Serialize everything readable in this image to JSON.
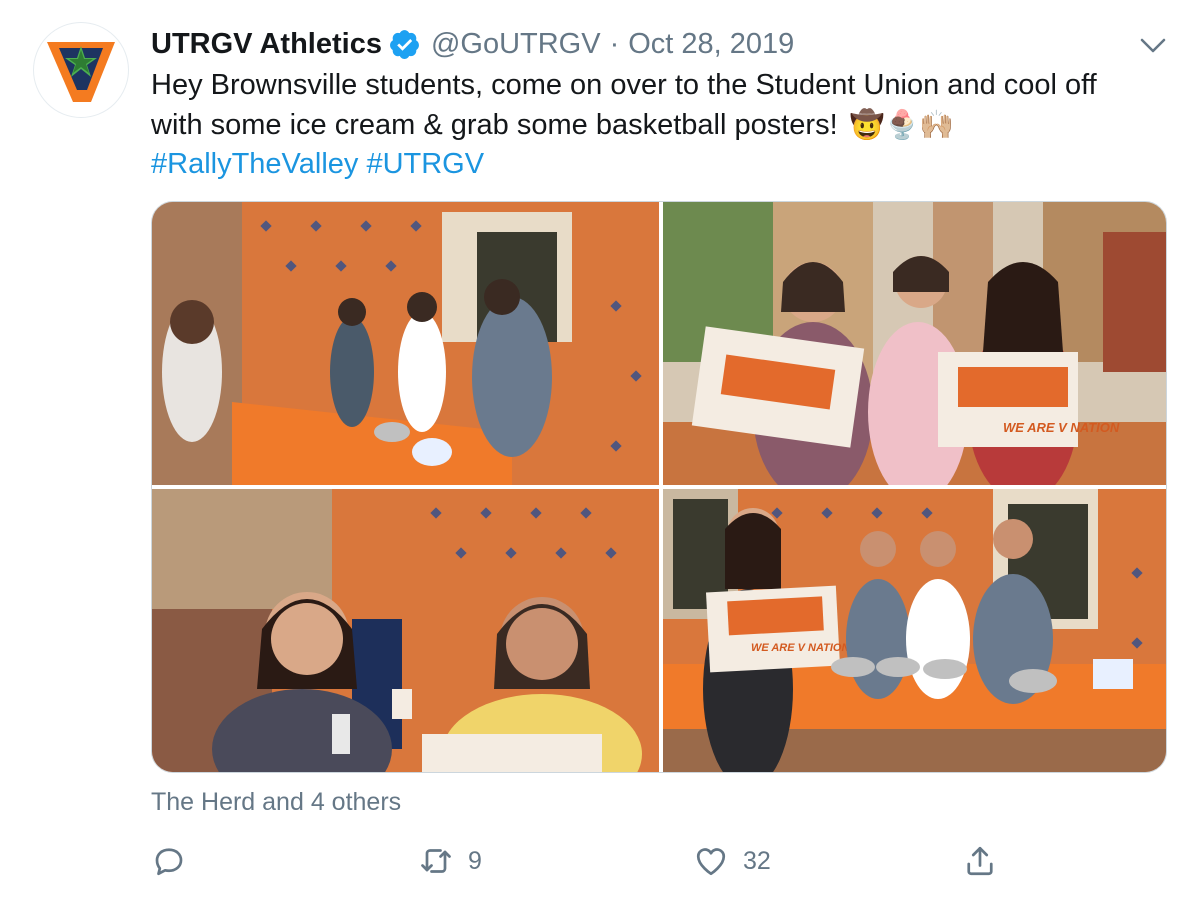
{
  "tweet": {
    "author": {
      "display_name": "UTRGV Athletics",
      "handle": "@GoUTRGV",
      "verified": true,
      "avatar_icon": "utrgv-v-logo"
    },
    "date_separator": "·",
    "date": "Oct 28, 2019",
    "text_line1": "Hey Brownsville students, come on over to the Student Union and cool off",
    "text_line2": "with some ice cream & grab some basketball posters!",
    "emojis": "🤠🍨🙌🏼",
    "hashtags": [
      "#RallyTheValley",
      "#UTRGV"
    ],
    "media": [
      {
        "icon": "photo-ice-cream-table"
      },
      {
        "icon": "photo-students-holding-posters"
      },
      {
        "icon": "photo-two-students-selfie"
      },
      {
        "icon": "photo-staff-at-ice-cream-table"
      }
    ],
    "poster_text": "WE ARE V NATION",
    "liked_by": "The Herd and 4 others",
    "actions": {
      "reply_count": "",
      "retweet_count": "9",
      "like_count": "32",
      "share_count": ""
    },
    "colors": {
      "accent": "#1b95e0",
      "verified": "#1da1f2",
      "muted": "#657786",
      "brick": "#d9773c"
    }
  }
}
